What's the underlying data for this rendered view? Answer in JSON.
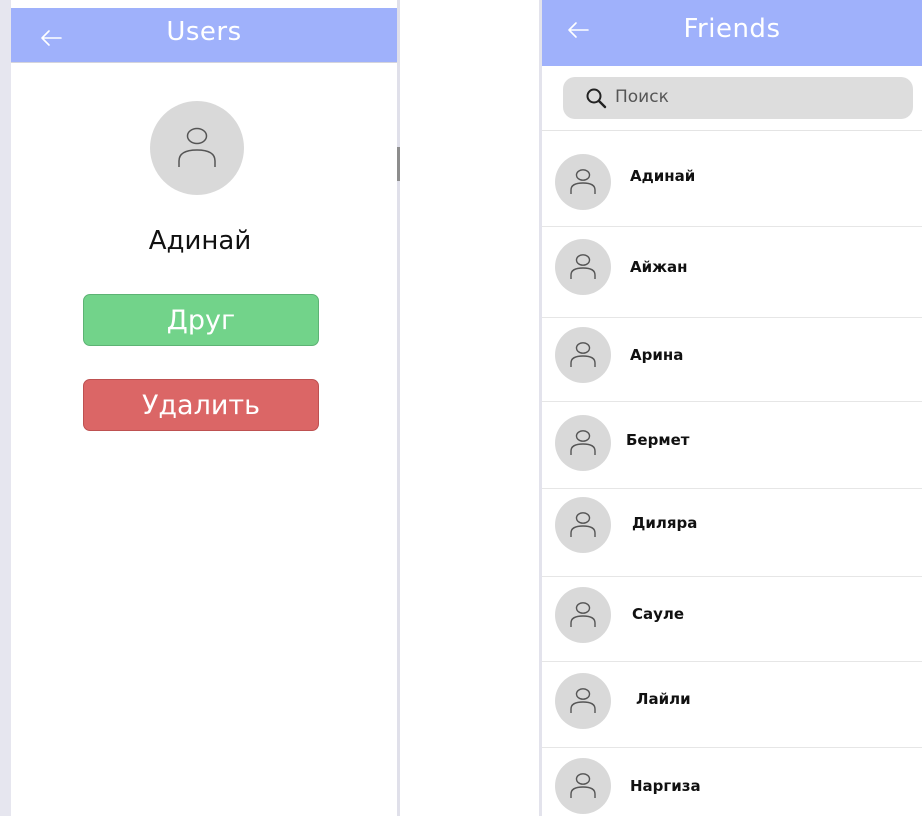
{
  "colors": {
    "appbar": "#9fb1fb",
    "friend_button": "#72d38a",
    "delete_button": "#db6666",
    "avatar_bg": "#d9d9d9",
    "search_bg": "#dddddd"
  },
  "left_screen": {
    "appbar": {
      "back_icon": "arrow-left-icon",
      "title": "Users"
    },
    "profile": {
      "avatar_icon": "user-icon",
      "name": "Адинай",
      "friend_button": "Друг",
      "delete_button": "Удалить"
    }
  },
  "right_screen": {
    "appbar": {
      "back_icon": "arrow-left-icon",
      "title": "Friends"
    },
    "search": {
      "icon": "search-icon",
      "placeholder": "Поиск"
    },
    "friends": [
      {
        "name": "Адинай"
      },
      {
        "name": "Айжан"
      },
      {
        "name": "Арина"
      },
      {
        "name": "Бермет"
      },
      {
        "name": "Диляра"
      },
      {
        "name": "Сауле"
      },
      {
        "name": "Лайли"
      },
      {
        "name": "Наргиза"
      }
    ]
  }
}
